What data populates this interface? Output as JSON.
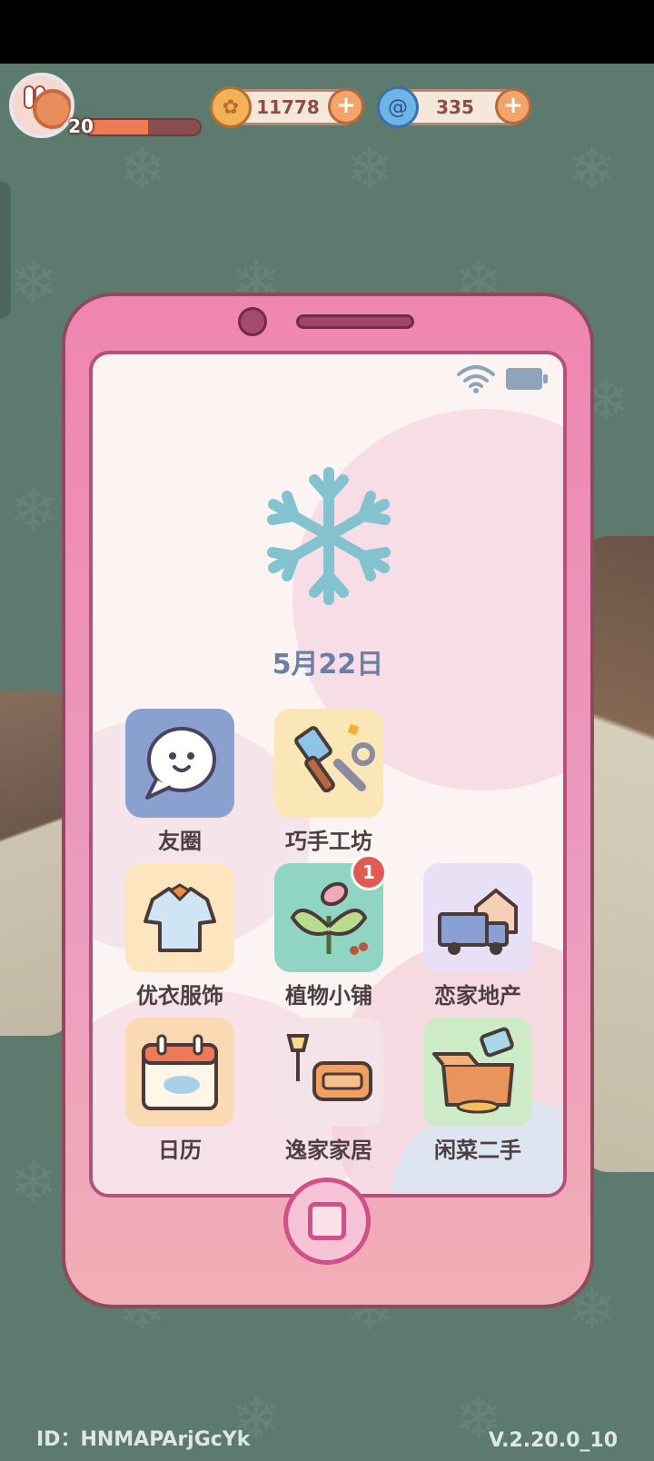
{
  "player": {
    "level": "20",
    "level_progress": 0.55
  },
  "currencies": [
    {
      "name": "coins",
      "value": "11778",
      "icon": "coin-icon"
    },
    {
      "name": "swirl",
      "value": "335",
      "icon": "swirl-icon"
    }
  ],
  "phone": {
    "date": "5月22日",
    "apps": [
      {
        "label": "友圈",
        "icon": "chat-bubble-icon",
        "badge": null
      },
      {
        "label": "巧手工坊",
        "icon": "brush-wrench-icon",
        "badge": null
      },
      {
        "label": "优衣服饰",
        "icon": "shirt-icon",
        "badge": null
      },
      {
        "label": "植物小铺",
        "icon": "plant-icon",
        "badge": "1"
      },
      {
        "label": "恋家地产",
        "icon": "truck-house-icon",
        "badge": null
      },
      {
        "label": "日历",
        "icon": "calendar-icon",
        "badge": null
      },
      {
        "label": "逸家家居",
        "icon": "sofa-lamp-icon",
        "badge": null
      },
      {
        "label": "闲菜二手",
        "icon": "box-tag-icon",
        "badge": null
      }
    ]
  },
  "footer": {
    "id": "ID：HNMAPArjGcYk",
    "version": "V.2.20.0_10"
  },
  "colors": {
    "background": "#5d7a6e",
    "phone_body": "#ec9bbf",
    "date_text": "#6a7fa8",
    "badge": "#e35a52"
  }
}
